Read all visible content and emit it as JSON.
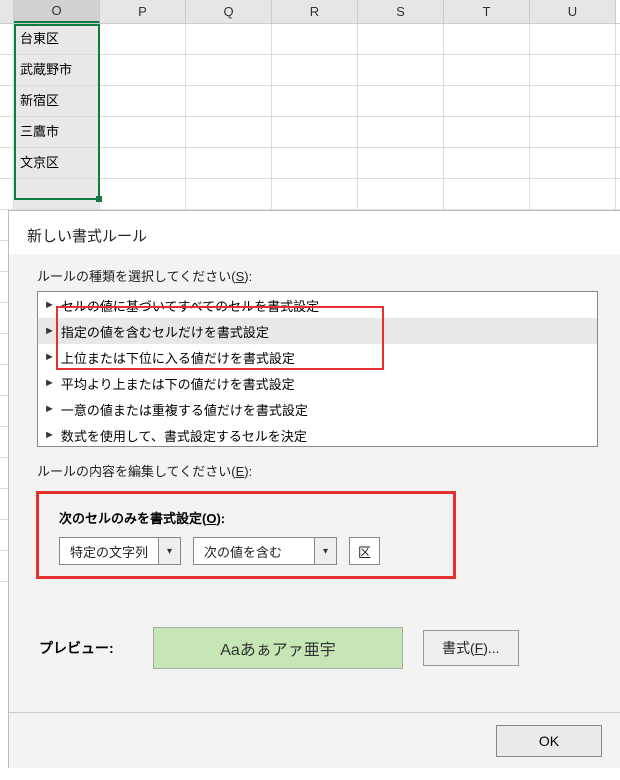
{
  "columns": [
    "O",
    "P",
    "Q",
    "R",
    "S",
    "T",
    "U"
  ],
  "selected_column_index": 0,
  "cells_col_O": [
    "台東区",
    "武蔵野市",
    "新宿区",
    "三鷹市",
    "文京区"
  ],
  "dialog": {
    "title": "新しい書式ルール",
    "select_rule_type_label": "ルールの種類を選択してください(",
    "select_rule_type_key": "S",
    "label_close": "):",
    "rule_types": [
      "セルの値に基づいてすべてのセルを書式設定",
      "指定の値を含むセルだけを書式設定",
      "上位または下位に入る値だけを書式設定",
      "平均より上または下の値だけを書式設定",
      "一意の値または重複する値だけを書式設定",
      "数式を使用して、書式設定するセルを決定"
    ],
    "selected_rule_index": 1,
    "edit_rule_label": "ルールの内容を編集してください(",
    "edit_rule_key": "E",
    "format_only_label": "次のセルのみを書式設定(",
    "format_only_key": "O",
    "combo1": "特定の文字列",
    "combo2": "次の値を含む",
    "text_value": "区",
    "preview_label": "プレビュー:",
    "preview_sample": "Aaあぁアァ亜宇",
    "format_button": "書式(",
    "format_button_key": "F",
    "format_button_tail": ")...",
    "ok": "OK"
  }
}
